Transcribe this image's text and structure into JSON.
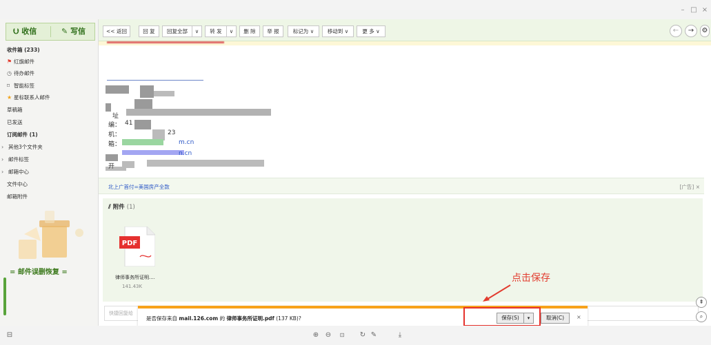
{
  "window": {
    "minimize": "–",
    "restore": "□",
    "close": "×"
  },
  "sidebar": {
    "receive": "收信",
    "compose": "写信",
    "folders": [
      {
        "label": "收件箱 (233)",
        "bold": true,
        "icon": ""
      },
      {
        "label": "红旗邮件",
        "icon": "flag-icon"
      },
      {
        "label": "待办邮件",
        "icon": "clock-icon"
      },
      {
        "label": "智能标签",
        "icon": "tag-icon"
      },
      {
        "label": "星标联系人邮件",
        "icon": "star-icon"
      },
      {
        "label": "草稿箱",
        "icon": ""
      },
      {
        "label": "已发送",
        "icon": ""
      },
      {
        "label": "订阅邮件 (1)",
        "bold": true,
        "icon": ""
      },
      {
        "label": "其他3个文件夹",
        "icon": "chevron-right-icon"
      },
      {
        "label": "邮件标签",
        "icon": "chevron-right-icon"
      },
      {
        "label": "邮箱中心",
        "icon": "chevron-right-icon"
      },
      {
        "label": "文件中心",
        "icon": ""
      },
      {
        "label": "邮箱附件",
        "icon": ""
      }
    ],
    "recover_banner": "= 邮件误删恢复 ="
  },
  "toolbar": {
    "back": "<< 返回",
    "reply": "回 复",
    "reply_all": "回复全部",
    "reply_all_dd": "∨",
    "forward": "转 发",
    "forward_dd": "∨",
    "delete": "删 除",
    "report": "举 报",
    "mark_as": "标记为 ∨",
    "move_to": "移动到 ∨",
    "more": "更 多 ∨",
    "prev": "←",
    "next": "→"
  },
  "email": {
    "lines": [
      "址",
      "编：",
      "机：",
      "箱：",
      "开"
    ],
    "partial_digits": [
      "41",
      "23"
    ],
    "links": [
      "m.cn",
      "n.cn"
    ]
  },
  "ad": {
    "link": "北上广首付=美国房产全款",
    "tag": "[广告] ×"
  },
  "attachments": {
    "title": "附件",
    "count": "(1)",
    "file_type": "PDF",
    "file_name": "律师事务所证明....",
    "file_size": "141.43K"
  },
  "quickreply": {
    "placeholder": "快捷回复给"
  },
  "annotation": {
    "text": "点击保存"
  },
  "download": {
    "prefix": "是否保存来自 ",
    "host": "mail.126.com",
    "middle": " 的 ",
    "file": "律师事务所证明.pdf",
    "size": " (137 KB)?",
    "save": "保存(S)",
    "save_dd": "▾",
    "cancel": "取消(C)",
    "close": "×"
  },
  "colors": {
    "accent_green": "#3d7a1e",
    "toolbar_bg": "#eef6e6",
    "annotation_red": "#e23c2f",
    "download_orange": "#f7a21b"
  }
}
